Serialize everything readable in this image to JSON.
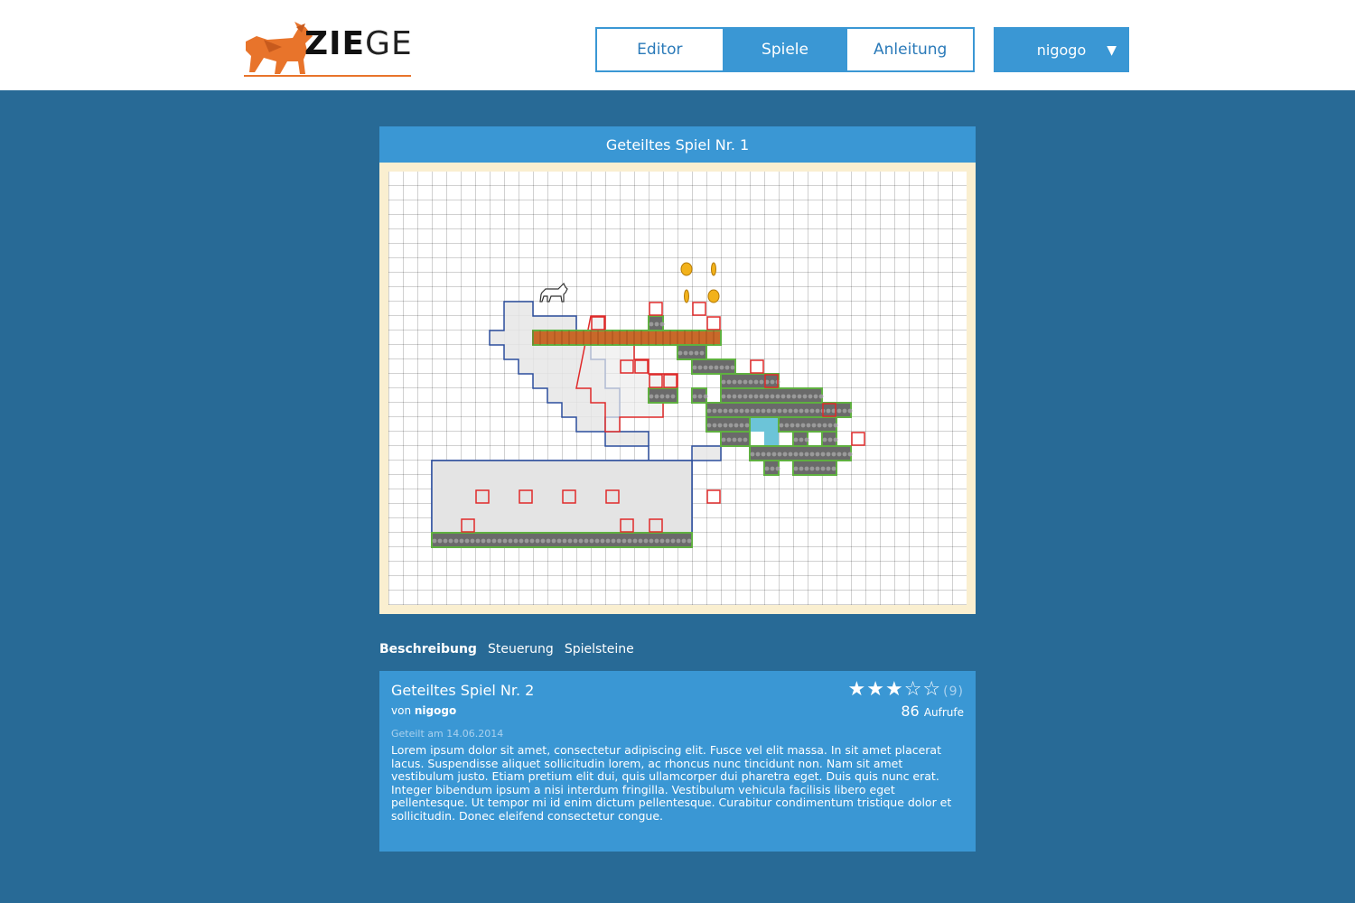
{
  "brand": {
    "name_bold": "ZIE",
    "name_light": "GE",
    "accent": "#e8742b"
  },
  "nav": {
    "items": [
      {
        "label": "Editor",
        "active": false
      },
      {
        "label": "Spiele",
        "active": true
      },
      {
        "label": "Anleitung",
        "active": false
      }
    ]
  },
  "user": {
    "name": "nigogo",
    "caret": "▼"
  },
  "game": {
    "title": "Geteiltes Spiel Nr. 1"
  },
  "tabs": [
    {
      "label": "Beschreibung",
      "active": true
    },
    {
      "label": "Steuerung",
      "active": false
    },
    {
      "label": "Spielsteine",
      "active": false
    }
  ],
  "info": {
    "title": "Geteiltes Spiel Nr. 2",
    "author_prefix": "von",
    "author": "nigogo",
    "date": "Geteilt am 14.06.2014",
    "description": "Lorem ipsum dolor sit amet, consectetur adipiscing elit. Fusce vel elit massa. In sit amet placerat lacus. Suspendisse aliquet sollicitudin lorem, ac rhoncus nunc tincidunt non. Nam sit amet vestibulum justo. Etiam pretium elit dui, quis ullamcorper dui pharetra eget. Duis quis nunc erat. Integer bibendum ipsum a nisi interdum fringilla. Vestibulum vehicula facilisis libero eget pellentesque. Ut tempor mi id enim dictum pellentesque. Curabitur condimentum tristique dolor et sollicitudin. Donec eleifend consectetur congue.",
    "rating": {
      "value": 3,
      "max": 5,
      "count": "(9)"
    },
    "views": {
      "value": "86",
      "label": "Aufrufe"
    }
  },
  "colors": {
    "page_bg": "#286a96",
    "accent_blue": "#3a97d4",
    "frame_bg": "#faefd0",
    "ground_outline": "#5fb040",
    "zone_blue": "#2d4f9e",
    "zone_red": "#e02a2a",
    "brick": "#c8692a",
    "water": "#6cc4d8",
    "coin": "#f2b21b"
  }
}
